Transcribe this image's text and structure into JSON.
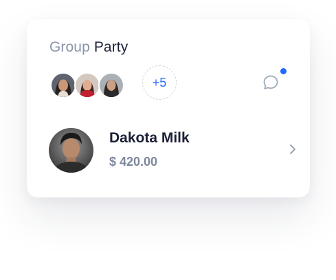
{
  "card": {
    "title_prefix": "Group",
    "title_main": "Party"
  },
  "members": {
    "avatars": [
      {
        "icon": "member-avatar-1"
      },
      {
        "icon": "member-avatar-2"
      },
      {
        "icon": "member-avatar-3"
      }
    ],
    "more_count": "+5"
  },
  "chat": {
    "icon": "chat-bubble-icon",
    "has_notification": true
  },
  "person": {
    "name": "Dakota Milk",
    "amount": "$ 420.00"
  },
  "colors": {
    "accent": "#2f6cff",
    "notification_dot": "#1f6bff",
    "title_light": "#8a94a8",
    "title_dark": "#1f2338",
    "muted": "#7d879c"
  }
}
